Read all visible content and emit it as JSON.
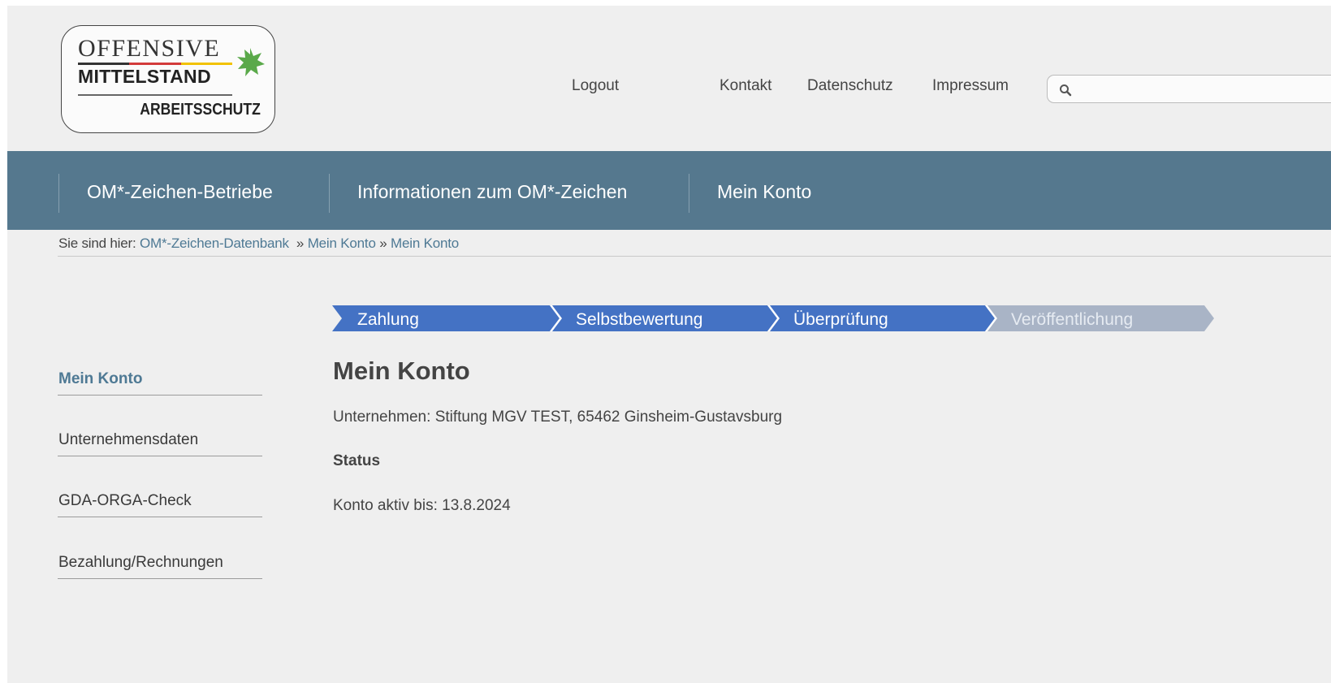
{
  "logo": {
    "line1": "OFFENSIVE",
    "line2": "MITTELSTAND",
    "line3": "ARBEITSSCHUTZ",
    "colors": [
      "#333333",
      "#d33a3a",
      "#f2c200"
    ],
    "star_color": "#5aa94a"
  },
  "topnav": {
    "logout": "Logout",
    "kontakt": "Kontakt",
    "datenschutz": "Datenschutz",
    "impressum": "Impressum"
  },
  "search": {
    "placeholder": "",
    "value": "",
    "icon": "search-icon"
  },
  "mainnav": {
    "items": [
      {
        "label": "OM*-Zeichen-Betriebe"
      },
      {
        "label": "Informationen zum OM*-Zeichen"
      },
      {
        "label": "Mein Konto"
      }
    ],
    "background": "#55788e"
  },
  "breadcrumb": {
    "prefix": "Sie sind hier:",
    "items": [
      "OM*-Zeichen-Datenbank",
      "Mein Konto",
      "Mein Konto"
    ],
    "separator": "»"
  },
  "sidebar": {
    "items": [
      {
        "label": "Mein Konto",
        "active": true
      },
      {
        "label": "Unternehmensdaten",
        "active": false
      },
      {
        "label": "GDA-ORGA-Check",
        "active": false
      },
      {
        "label": "Bezahlung/Rechnungen",
        "active": false
      }
    ]
  },
  "steps": {
    "items": [
      {
        "label": "Zahlung",
        "done": true
      },
      {
        "label": "Selbstbewertung",
        "done": true
      },
      {
        "label": "Überprüfung",
        "done": true
      },
      {
        "label": "Veröffentlichung",
        "done": false
      }
    ],
    "active_color": "#4472c4",
    "inactive_color": "#a9b4c6"
  },
  "content": {
    "title": "Mein Konto",
    "company_label": "Unternehmen:",
    "company_value": "Stiftung MGV TEST, 65462 Ginsheim-Gustavsburg",
    "status_heading": "Status",
    "active_label": "Konto aktiv bis:",
    "active_until": "13.8.2024"
  }
}
